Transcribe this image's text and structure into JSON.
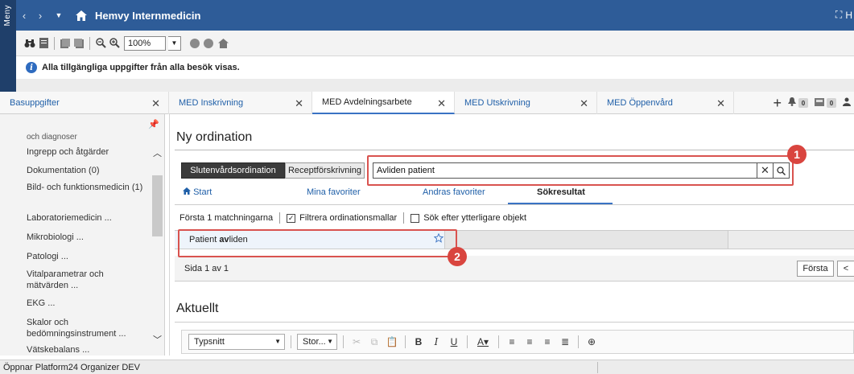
{
  "meny_label": "Meny",
  "titlebar": {
    "title": "Hemvy Internmedicin",
    "right_text": "H"
  },
  "toolbar": {
    "zoom": "100%"
  },
  "info": {
    "text": "Alla tillgängliga uppgifter från alla besök visas."
  },
  "tabs": [
    {
      "label": "Basuppgifter"
    },
    {
      "label": "MED Inskrivning"
    },
    {
      "label": "MED Avdelningsarbete"
    },
    {
      "label": "MED Utskrivning"
    },
    {
      "label": "MED Öppenvård"
    }
  ],
  "tab_badges": [
    "0",
    "0"
  ],
  "sidebar": {
    "items": [
      "och diagnoser",
      "Ingrepp och åtgärder",
      "Dokumentation (0)",
      "Bild- och funktionsmedicin (1)",
      "Laboratoriemedicin ...",
      "Mikrobiologi ...",
      "Patologi ...",
      "Vitalparametrar och mätvärden ...",
      "EKG ...",
      "Skalor och bedömningsinstrument ...",
      "Vätskebalans ..."
    ]
  },
  "main": {
    "title": "Ny ordination",
    "btn_slutenvard": "Slutenvårdsordination",
    "btn_recept": "Receptförskrivning",
    "search_value": "Avliden patient",
    "subtabs": [
      "Start",
      "Mina favoriter",
      "Andras favoriter",
      "Sökresultat"
    ],
    "filter": {
      "matches": "Första 1 matchningarna",
      "filter_templates": "Filtrera ordinationsmallar",
      "search_more": "Sök efter ytterligare objekt"
    },
    "result": {
      "prefix": "Patient ",
      "bold": "av",
      "suffix": "liden"
    },
    "pager": {
      "text": "Sida 1 av 1",
      "first": "Första",
      "prev": "<"
    },
    "section_title": "Aktuellt",
    "editor": {
      "font": "Typsnitt",
      "size": "Stor..."
    }
  },
  "callouts": [
    "1",
    "2"
  ],
  "statusbar": {
    "text": "Öppnar Platform24 Organizer DEV"
  },
  "colors": {
    "titlebar": "#2e5c98",
    "accent": "#3a73c4",
    "callout": "#d9453f"
  }
}
